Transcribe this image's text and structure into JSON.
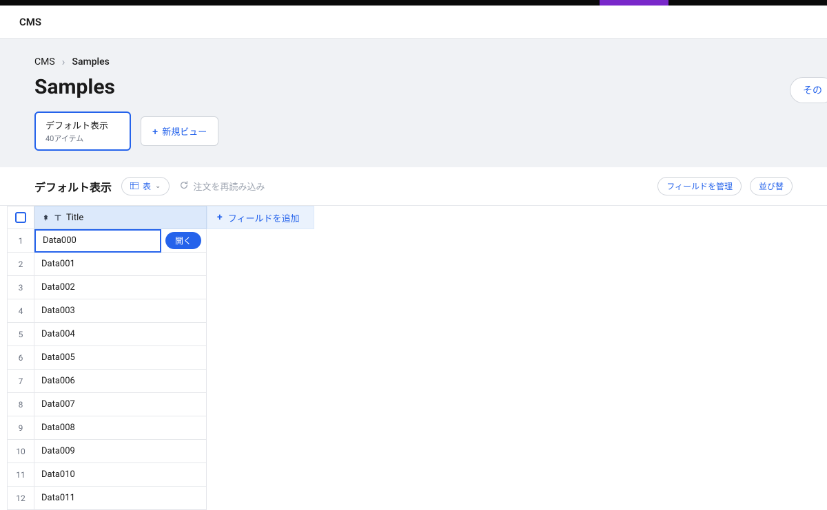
{
  "header": {
    "app_title": "CMS"
  },
  "breadcrumb": {
    "root": "CMS",
    "current": "Samples"
  },
  "page": {
    "title": "Samples",
    "etc_button": "その"
  },
  "views": {
    "current": {
      "title": "デフォルト表示",
      "subtitle": "40アイテム"
    },
    "new_view_btn": "新規ビュー"
  },
  "toolbar": {
    "section_title": "デフォルト表示",
    "view_type_btn": "表",
    "reload_btn": "注文を再読み込み",
    "manage_fields_btn": "フィールドを管理",
    "sort_btn": "並び替"
  },
  "table": {
    "title_col": "Title",
    "add_field_btn": "フィールドを追加",
    "open_btn": "開く",
    "rows": [
      {
        "num": "1",
        "value": "Data000"
      },
      {
        "num": "2",
        "value": "Data001"
      },
      {
        "num": "3",
        "value": "Data002"
      },
      {
        "num": "4",
        "value": "Data003"
      },
      {
        "num": "5",
        "value": "Data004"
      },
      {
        "num": "6",
        "value": "Data005"
      },
      {
        "num": "7",
        "value": "Data006"
      },
      {
        "num": "8",
        "value": "Data007"
      },
      {
        "num": "9",
        "value": "Data008"
      },
      {
        "num": "10",
        "value": "Data009"
      },
      {
        "num": "11",
        "value": "Data010"
      },
      {
        "num": "12",
        "value": "Data011"
      }
    ]
  }
}
